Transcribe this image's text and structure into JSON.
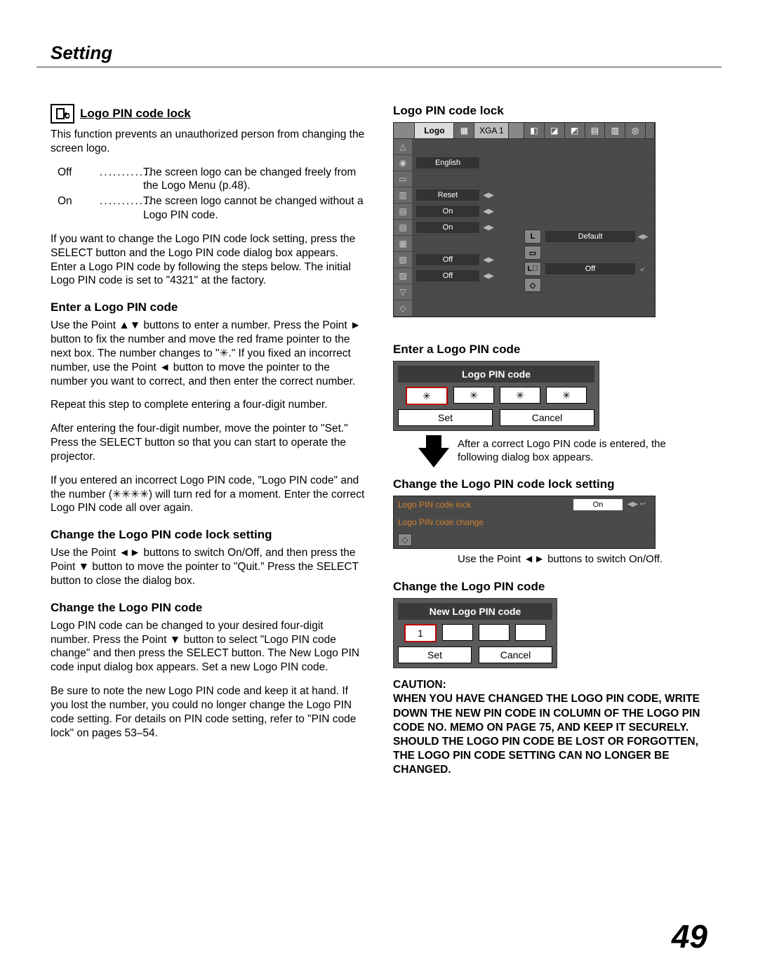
{
  "header": {
    "title": "Setting"
  },
  "left": {
    "heading1": "Logo PIN code lock",
    "intro": "This function prevents an unauthorized person from changing the screen logo.",
    "off_key": "Off",
    "off_val": "The screen logo can be changed freely from the Logo Menu (p.48).",
    "on_key": "On",
    "on_val": "The screen logo cannot be changed without a Logo PIN code.",
    "para2": "If you want to change the Logo PIN code lock setting, press the SELECT button and the Logo PIN code dialog box appears. Enter a Logo PIN code by following the steps below. The initial Logo PIN code is set to \"4321\" at the factory.",
    "enter_heading": "Enter a Logo PIN code",
    "enter_p1": "Use the Point ▲▼ buttons to enter a number. Press the Point ► button to fix the number and move the red frame pointer to the next box. The number changes to \"✳.\" If you fixed an incorrect number, use the Point ◄ button to move the pointer to the number you want to correct, and then enter the correct number.",
    "enter_p2": "Repeat this step to complete entering a four-digit number.",
    "enter_p3": "After entering the four-digit number, move the pointer to \"Set.\" Press the SELECT button so that you can start to operate the projector.",
    "enter_p4": "If you entered an incorrect Logo PIN code, \"Logo PIN code\" and the number (✳✳✳✳) will turn red for a moment. Enter the correct Logo PIN code all over again.",
    "change_lock_heading": "Change the Logo PIN code lock setting",
    "change_lock_p": "Use the Point ◄► buttons to switch On/Off, and then press the Point ▼ button to move the pointer to \"Quit.\" Press the SELECT button to close the dialog box.",
    "change_pin_heading": "Change the Logo PIN code",
    "change_pin_p1": "Logo PIN code can be changed to your desired four-digit number. Press the Point ▼ button to select \"Logo PIN code change\" and then press the SELECT button. The New Logo PIN code input dialog box appears. Set a new Logo PIN code.",
    "change_pin_p2": "Be sure to note the new Logo PIN code and keep it at hand. If you lost the number, you could no longer change the Logo PIN code setting. For details on PIN code setting, refer to \"PIN code lock\" on pages 53–54."
  },
  "right": {
    "panel_heading": "Logo PIN code lock",
    "panel_top_label": "Logo",
    "panel_top_mode": "XGA 1",
    "settings": {
      "english": "English",
      "reset": "Reset",
      "on1": "On",
      "on2": "On",
      "off1": "Off",
      "off2": "Off",
      "default": "Default",
      "off3": "Off"
    },
    "enter_heading": "Enter a Logo PIN code",
    "pin_title": "Logo PIN code",
    "pin_star": "✳",
    "set": "Set",
    "cancel": "Cancel",
    "after_text": "After a correct Logo PIN code is entered, the following dialog box appears.",
    "change_lock_heading": "Change the Logo PIN code lock setting",
    "lock_label1": "Logo PIN code lock",
    "lock_val1": "On",
    "lock_label2": "Logo PIN code change",
    "hint": "Use the Point ◄► buttons to switch On/Off.",
    "change_pin_heading": "Change the Logo PIN code",
    "new_pin_title": "New Logo PIN code",
    "new_pin_first": "1",
    "caution_title": "caution:",
    "caution_body": "when you have changed the logo PIN code, write down the new pin code in column of the LOGO PIN code no. memo on page 75, and keep it securely. should the LOGO PIN code be lost or forgotten, THE LOGO PIN code SETTING can no longer be changed."
  },
  "page_number": "49"
}
